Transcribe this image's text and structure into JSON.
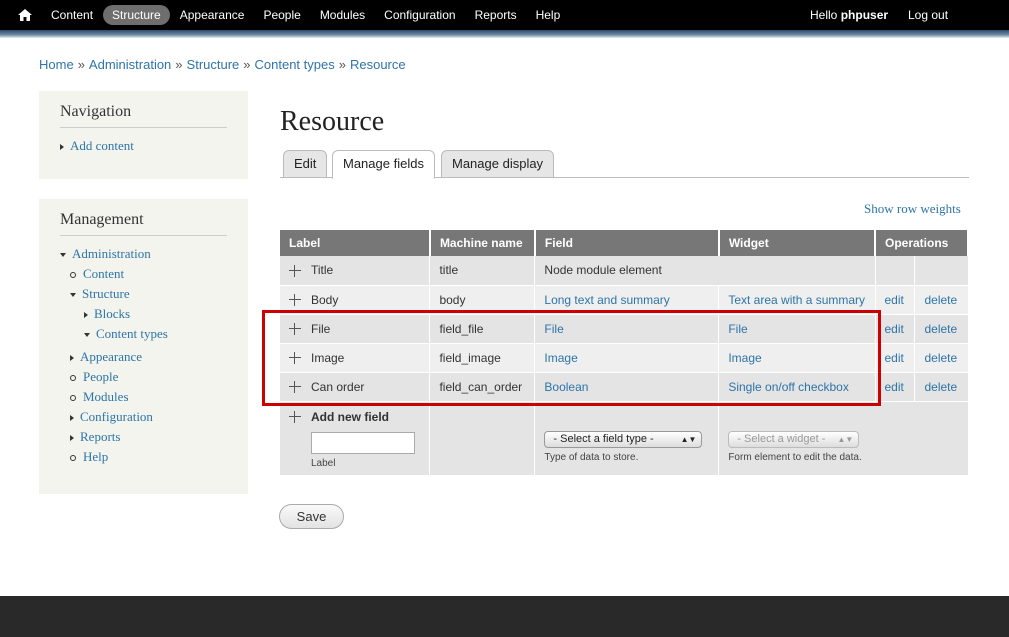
{
  "toolbar": {
    "menu": [
      "Content",
      "Structure",
      "Appearance",
      "People",
      "Modules",
      "Configuration",
      "Reports",
      "Help"
    ],
    "active": "Structure",
    "hello": "Hello",
    "username": "phpuser",
    "logout": "Log out"
  },
  "breadcrumb": [
    "Home",
    "Administration",
    "Structure",
    "Content types",
    "Resource"
  ],
  "navigation": {
    "title": "Navigation",
    "add_content": "Add content"
  },
  "management": {
    "title": "Management",
    "administration": "Administration",
    "content": "Content",
    "structure": "Structure",
    "blocks": "Blocks",
    "content_types": "Content types",
    "appearance": "Appearance",
    "people": "People",
    "modules": "Modules",
    "configuration": "Configuration",
    "reports": "Reports",
    "help": "Help"
  },
  "page_title": "Resource",
  "tabs": {
    "edit": "Edit",
    "manage_fields": "Manage fields",
    "manage_display": "Manage display"
  },
  "show_row_weights": "Show row weights",
  "table": {
    "headers": [
      "Label",
      "Machine name",
      "Field",
      "Widget",
      "Operations"
    ],
    "rows": [
      {
        "label": "Title",
        "machine": "title",
        "field": "Node module element",
        "widget": "",
        "edit": "",
        "delete": ""
      },
      {
        "label": "Body",
        "machine": "body",
        "field": "Long text and summary",
        "widget": "Text area with a summary",
        "edit": "edit",
        "delete": "delete"
      },
      {
        "label": "File",
        "machine": "field_file",
        "field": "File",
        "widget": "File",
        "edit": "edit",
        "delete": "delete"
      },
      {
        "label": "Image",
        "machine": "field_image",
        "field": "Image",
        "widget": "Image",
        "edit": "edit",
        "delete": "delete"
      },
      {
        "label": "Can order",
        "machine": "field_can_order",
        "field": "Boolean",
        "widget": "Single on/off checkbox",
        "edit": "edit",
        "delete": "delete"
      }
    ],
    "add_new": {
      "title": "Add new field",
      "label_caption": "Label",
      "field_select": "- Select a field type -",
      "field_desc": "Type of data to store.",
      "widget_select": "- Select a widget -",
      "widget_desc": "Form element to edit the data."
    }
  },
  "save": "Save"
}
